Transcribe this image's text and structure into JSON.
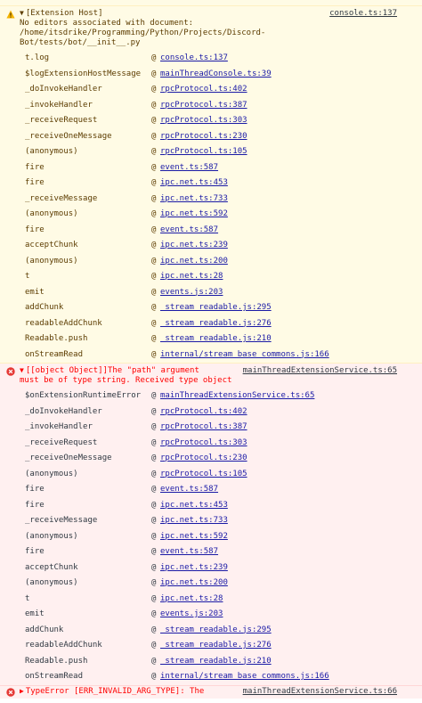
{
  "top_partial": "·· ·· ·· ·····",
  "warning": {
    "icon": "warning-icon",
    "tag": "[Extension Host]",
    "lines": [
      "No editors associated with document:",
      "/home/itsdrike/Programming/Python/Projects/Discord-",
      "Bot/tests/bot/__init__.py"
    ],
    "source": "console.ts:137",
    "stack": [
      {
        "fn": "t.log",
        "loc": "console.ts:137"
      },
      {
        "fn": "$logExtensionHostMessage",
        "loc": "mainThreadConsole.ts:39"
      },
      {
        "fn": "_doInvokeHandler",
        "loc": "rpcProtocol.ts:402"
      },
      {
        "fn": "_invokeHandler",
        "loc": "rpcProtocol.ts:387"
      },
      {
        "fn": "_receiveRequest",
        "loc": "rpcProtocol.ts:303"
      },
      {
        "fn": "_receiveOneMessage",
        "loc": "rpcProtocol.ts:230"
      },
      {
        "fn": "(anonymous)",
        "loc": "rpcProtocol.ts:105"
      },
      {
        "fn": "fire",
        "loc": "event.ts:587"
      },
      {
        "fn": "fire",
        "loc": "ipc.net.ts:453"
      },
      {
        "fn": "_receiveMessage",
        "loc": "ipc.net.ts:733"
      },
      {
        "fn": "(anonymous)",
        "loc": "ipc.net.ts:592"
      },
      {
        "fn": "fire",
        "loc": "event.ts:587"
      },
      {
        "fn": "acceptChunk",
        "loc": "ipc.net.ts:239"
      },
      {
        "fn": "(anonymous)",
        "loc": "ipc.net.ts:200"
      },
      {
        "fn": "t",
        "loc": "ipc.net.ts:28"
      },
      {
        "fn": "emit",
        "loc": "events.js:203"
      },
      {
        "fn": "addChunk",
        "loc": "_stream_readable.js:295"
      },
      {
        "fn": "readableAddChunk",
        "loc": "_stream_readable.js:276"
      },
      {
        "fn": "Readable.push",
        "loc": "_stream_readable.js:210"
      },
      {
        "fn": "onStreamRead",
        "loc": "internal/stream_base_commons.js:166"
      }
    ]
  },
  "error": {
    "icon": "error-icon",
    "lines": [
      "[[object Object]]The \"path\" argument",
      "must be of type string. Received type object"
    ],
    "source": "mainThreadExtensionService.ts:65",
    "stack": [
      {
        "fn": "$onExtensionRuntimeError",
        "loc": "mainThreadExtensionService.ts:65"
      },
      {
        "fn": "_doInvokeHandler",
        "loc": "rpcProtocol.ts:402"
      },
      {
        "fn": "_invokeHandler",
        "loc": "rpcProtocol.ts:387"
      },
      {
        "fn": "_receiveRequest",
        "loc": "rpcProtocol.ts:303"
      },
      {
        "fn": "_receiveOneMessage",
        "loc": "rpcProtocol.ts:230"
      },
      {
        "fn": "(anonymous)",
        "loc": "rpcProtocol.ts:105"
      },
      {
        "fn": "fire",
        "loc": "event.ts:587"
      },
      {
        "fn": "fire",
        "loc": "ipc.net.ts:453"
      },
      {
        "fn": "_receiveMessage",
        "loc": "ipc.net.ts:733"
      },
      {
        "fn": "(anonymous)",
        "loc": "ipc.net.ts:592"
      },
      {
        "fn": "fire",
        "loc": "event.ts:587"
      },
      {
        "fn": "acceptChunk",
        "loc": "ipc.net.ts:239"
      },
      {
        "fn": "(anonymous)",
        "loc": "ipc.net.ts:200"
      },
      {
        "fn": "t",
        "loc": "ipc.net.ts:28"
      },
      {
        "fn": "emit",
        "loc": "events.js:203"
      },
      {
        "fn": "addChunk",
        "loc": "_stream_readable.js:295"
      },
      {
        "fn": "readableAddChunk",
        "loc": "_stream_readable.js:276"
      },
      {
        "fn": "Readable.push",
        "loc": "_stream_readable.js:210"
      },
      {
        "fn": "onStreamRead",
        "loc": "internal/stream_base_commons.js:166"
      }
    ]
  },
  "error2": {
    "icon": "error-icon",
    "text": "TypeError [ERR_INVALID_ARG_TYPE]: The",
    "source": "mainThreadExtensionService.ts:66"
  },
  "at_symbol": "@",
  "colors": {
    "warning_bg": "#fffbe5",
    "error_bg": "#fff0f0",
    "error_text": "#ff0000",
    "link": "#1a1aa6"
  }
}
